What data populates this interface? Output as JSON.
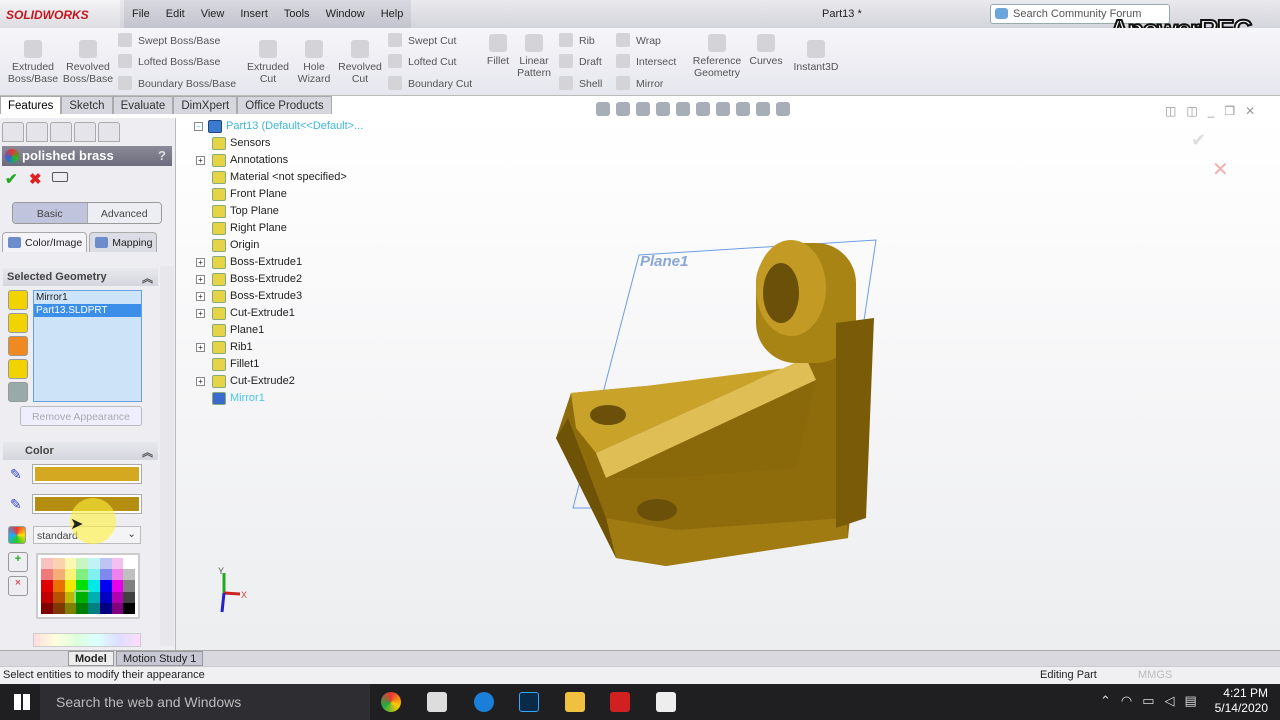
{
  "app": {
    "logo": "SOLIDWORKS",
    "doc_title": "Part13 *",
    "search_placeholder": "Search Community Forum",
    "watermark": "ApowerREC"
  },
  "menus": [
    "File",
    "Edit",
    "View",
    "Insert",
    "Tools",
    "Window",
    "Help"
  ],
  "ribbon": {
    "large": [
      "Extruded Boss/Base",
      "Revolved Boss/Base",
      "Extruded Cut",
      "Hole Wizard",
      "Revolved Cut",
      "Fillet",
      "Linear Pattern",
      "Reference Geometry",
      "Curves",
      "Instant3D"
    ],
    "small": [
      "Swept Boss/Base",
      "Lofted Boss/Base",
      "Boundary Boss/Base",
      "Swept Cut",
      "Lofted Cut",
      "Boundary Cut",
      "Rib",
      "Draft",
      "Shell",
      "Wrap",
      "Intersect",
      "Mirror"
    ]
  },
  "command_tabs": [
    "Features",
    "Sketch",
    "Evaluate",
    "DimXpert",
    "Office Products"
  ],
  "property_manager": {
    "title": "polished brass",
    "help": "?",
    "modes": [
      "Basic",
      "Advanced"
    ],
    "tabs": [
      "Color/Image",
      "Mapping"
    ],
    "selected_geometry": {
      "title": "Selected Geometry",
      "items": [
        "Mirror1",
        "Part13.SLDPRT"
      ],
      "selected": "Part13.SLDPRT"
    },
    "remove_button": "Remove Appearance",
    "color": {
      "title": "Color",
      "primary": "#d4a820",
      "secondary": "#b38e10",
      "palette_select": "standard"
    }
  },
  "palette_colors": [
    "#f9c0c0",
    "#fad2b0",
    "#fbf7b0",
    "#c8f5c0",
    "#c0f3f5",
    "#c0c4f5",
    "#f5c0f0",
    "#ffffff",
    "#f07a7a",
    "#f5ae78",
    "#fbf278",
    "#80ee80",
    "#80f0f0",
    "#8088f0",
    "#f080ec",
    "#c0c0c0",
    "#e00000",
    "#e87000",
    "#f0e800",
    "#00e000",
    "#00e8e8",
    "#0000f0",
    "#e800e8",
    "#808080",
    "#c00000",
    "#b85000",
    "#c0b800",
    "#00b000",
    "#00b0b0",
    "#0000c0",
    "#b000b0",
    "#404040",
    "#800000",
    "#803800",
    "#808000",
    "#008000",
    "#008080",
    "#000080",
    "#800080",
    "#000000"
  ],
  "tree": {
    "root": "Part13  (Default<<Default>...",
    "items": [
      {
        "label": "Sensors",
        "expand": false
      },
      {
        "label": "Annotations",
        "expand": true
      },
      {
        "label": "Material <not specified>",
        "expand": false
      },
      {
        "label": "Front Plane",
        "expand": false
      },
      {
        "label": "Top Plane",
        "expand": false
      },
      {
        "label": "Right Plane",
        "expand": false
      },
      {
        "label": "Origin",
        "expand": false
      },
      {
        "label": "Boss-Extrude1",
        "expand": true
      },
      {
        "label": "Boss-Extrude2",
        "expand": true
      },
      {
        "label": "Boss-Extrude3",
        "expand": true
      },
      {
        "label": "Cut-Extrude1",
        "expand": true
      },
      {
        "label": "Plane1",
        "expand": false
      },
      {
        "label": "Rib1",
        "expand": true
      },
      {
        "label": "Fillet1",
        "expand": false
      },
      {
        "label": "Cut-Extrude2",
        "expand": true
      },
      {
        "label": "Mirror1",
        "expand": false,
        "highlight": true
      }
    ]
  },
  "viewport": {
    "plane_label": "Plane1",
    "axis_x": "X",
    "axis_y": "Y",
    "part_color": "#b8901a"
  },
  "bottom_tabs": [
    "Model",
    "Motion Study 1"
  ],
  "status": {
    "message": "Select entities to modify their appearance",
    "mode": "Editing Part",
    "units": "MMGS"
  },
  "taskbar": {
    "search": "Search the web and Windows",
    "time": "4:21 PM",
    "date": "5/14/2020"
  }
}
